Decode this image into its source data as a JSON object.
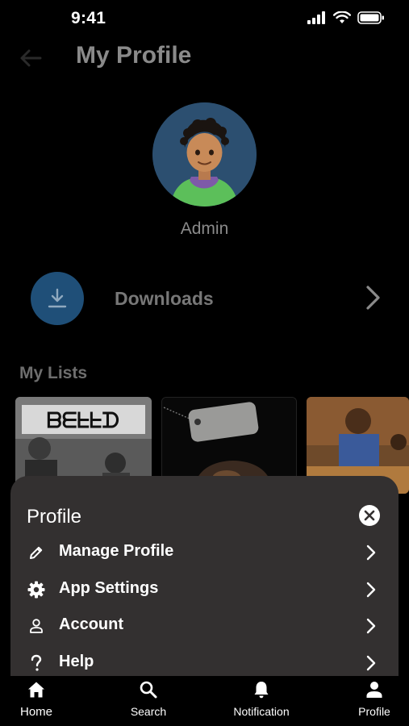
{
  "status_bar": {
    "time": "9:41"
  },
  "header": {
    "title": "My Profile"
  },
  "profile": {
    "name": "Admin"
  },
  "downloads": {
    "label": "Downloads"
  },
  "my_lists": {
    "title": "My Lists"
  },
  "sheet": {
    "title": "Profile",
    "items": [
      {
        "label": "Manage Profile",
        "icon": "pencil-icon"
      },
      {
        "label": "App Settings",
        "icon": "gear-icon"
      },
      {
        "label": "Account",
        "icon": "person-icon"
      },
      {
        "label": "Help",
        "icon": "question-icon"
      }
    ]
  },
  "bottom_nav": {
    "items": [
      {
        "label": "Home",
        "icon": "home-icon"
      },
      {
        "label": "Search",
        "icon": "search-icon"
      },
      {
        "label": "Notification",
        "icon": "bell-icon"
      },
      {
        "label": "Profile",
        "icon": "person-icon"
      }
    ]
  }
}
